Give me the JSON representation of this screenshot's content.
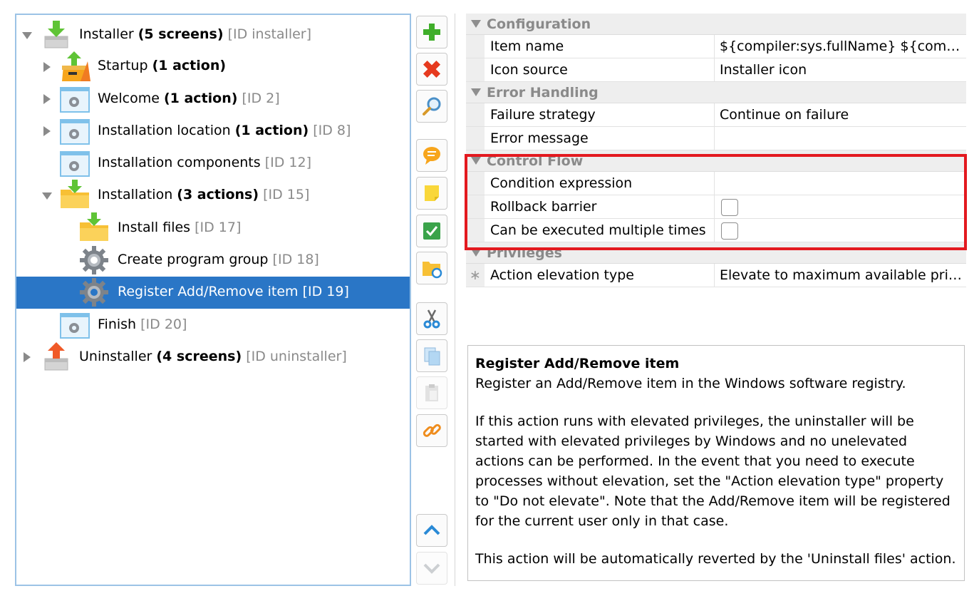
{
  "tree": {
    "items": [
      {
        "label": "Installer",
        "detail": "(5 screens)",
        "id_text": "[ID installer]",
        "icon": "installer-icon",
        "expanded": true
      },
      {
        "label": "Startup",
        "detail": "(1 action)",
        "id_text": "",
        "icon": "startup-icon",
        "expanded": false
      },
      {
        "label": "Welcome",
        "detail": "(1 action)",
        "id_text": "[ID 2]",
        "icon": "screen-gear-icon",
        "expanded": false
      },
      {
        "label": "Installation location",
        "detail": "(1 action)",
        "id_text": "[ID 8]",
        "icon": "screen-gear-icon",
        "expanded": false
      },
      {
        "label": "Installation components",
        "detail": "",
        "id_text": "[ID 12]",
        "icon": "screen-gear-icon"
      },
      {
        "label": "Installation",
        "detail": "(3 actions)",
        "id_text": "[ID 15]",
        "icon": "folder-download-icon",
        "expanded": true
      },
      {
        "label": "Install files",
        "detail": "",
        "id_text": "[ID 17]",
        "icon": "folder-download-icon"
      },
      {
        "label": "Create program group",
        "detail": "",
        "id_text": "[ID 18]",
        "icon": "gear-icon"
      },
      {
        "label": "Register Add/Remove item",
        "detail": "",
        "id_text": "[ID 19]",
        "icon": "gear-icon",
        "selected": true
      },
      {
        "label": "Finish",
        "detail": "",
        "id_text": "[ID 20]",
        "icon": "screen-gear-icon"
      },
      {
        "label": "Uninstaller",
        "detail": "(4 screens)",
        "id_text": "[ID uninstaller]",
        "icon": "uninstaller-icon",
        "expanded": false
      }
    ]
  },
  "toolbar": {
    "buttons": [
      "add-icon",
      "delete-icon",
      "search-icon",
      "comment-icon",
      "note-icon",
      "check-icon",
      "folder-sync-icon",
      "cut-icon",
      "copy-icon",
      "paste-icon",
      "link-icon",
      "move-up-icon",
      "move-down-icon"
    ]
  },
  "properties": {
    "configuration": {
      "title": "Configuration",
      "item_name_label": "Item name",
      "item_name_value": "${compiler:sys.fullName} ${compiler:sys.version}",
      "icon_source_label": "Icon source",
      "icon_source_value": "Installer icon"
    },
    "error_handling": {
      "title": "Error Handling",
      "failure_strategy_label": "Failure strategy",
      "failure_strategy_value": "Continue on failure",
      "error_message_label": "Error message",
      "error_message_value": ""
    },
    "control_flow": {
      "title": "Control Flow",
      "condition_label": "Condition expression",
      "condition_value": "",
      "rollback_label": "Rollback barrier",
      "rollback_checked": false,
      "multiple_label": "Can be executed multiple times",
      "multiple_checked": false
    },
    "privileges": {
      "title": "Privileges",
      "elevation_label": "Action elevation type",
      "elevation_value": "Elevate to maximum available privileges"
    }
  },
  "description": {
    "title": "Register Add/Remove item",
    "line1": "Register an Add/Remove item in the Windows software registry.",
    "para2": "If this action runs with elevated privileges, the uninstaller will be started with elevated privileges by Windows and no unelevated actions can be performed. In the event that you need to execute processes without elevation, set the \"Action elevation type\" property to \"Do not elevate\". Note that the Add/Remove item will be registered for the current user only in that case.",
    "para3": "This action will be automatically reverted by the 'Uninstall files' action."
  },
  "colors": {
    "selection": "#2a76c6",
    "highlight": "#e3191f",
    "panel_border": "#9cc3e6"
  }
}
